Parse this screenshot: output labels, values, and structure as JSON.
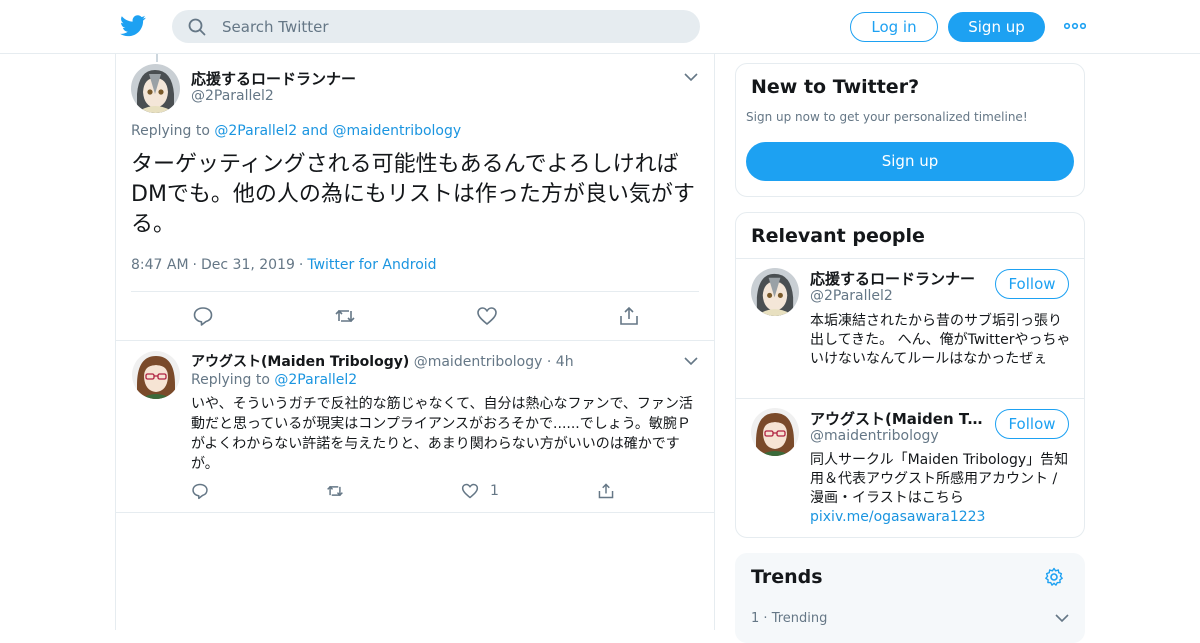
{
  "header": {
    "search_placeholder": "Search Twitter",
    "login_label": "Log in",
    "signup_label": "Sign up",
    "brand_color": "#1da1f2"
  },
  "main_tweet": {
    "display_name": "応援するロードランナー",
    "screen_name": "@2Parallel2",
    "replying_prefix": "Replying to",
    "replying_user1": "@2Parallel2",
    "replying_and": "and",
    "replying_user2": "@maidentribology",
    "text": "ターゲッティングされる可能性もあるんでよろしければDMでも。他の人の為にもリストは作った方が良い気がする。",
    "time": "8:47 AM",
    "date": "Dec 31, 2019",
    "source": "Twitter for Android"
  },
  "reply_tweet": {
    "display_name": "アウグスト(Maiden Tribology)",
    "screen_name": "@maidentribology",
    "age": "4h",
    "replying_prefix": "Replying to",
    "replying_user": "@2Parallel2",
    "text": "いや、そういうガチで反社的な筋じゃなくて、自分は熱心なファンで、ファン活動だと思っているが現実はコンプライアンスがおろそかで......でしょう。敏腕Ｐがよくわからない許諾を与えたりと、あまり関わらない方がいいのは確かですが。",
    "like_count": "1"
  },
  "sidebar": {
    "new_title": "New to Twitter?",
    "new_sub": "Sign up now to get your personalized timeline!",
    "new_signup": "Sign up",
    "people_title": "Relevant people",
    "people": [
      {
        "name": "応援するロードランナー",
        "screen": "@2Parallel2",
        "bio": "本垢凍結されたから昔のサブ垢引っ張り出してきた。 へん、俺がTwitterやっちゃいけないなんてルールはなかったぜぇ",
        "follow": "Follow"
      },
      {
        "name": "アウグスト(Maiden Tribology)",
        "screen": "@maidentribology",
        "bio": "同人サークル「Maiden Tribology」告知用＆代表アウグスト所感用アカウント / 漫画・イラストはこちら",
        "link": "pixiv.me/ogasawara1223",
        "follow": "Follow"
      }
    ],
    "trends_title": "Trends",
    "trend_rank": "1",
    "trend_label": "Trending"
  },
  "icons": [
    "twitter-bird-icon",
    "search-icon",
    "more-icon",
    "chevron-down-icon",
    "reply-icon",
    "retweet-icon",
    "like-icon",
    "share-icon",
    "gear-icon"
  ]
}
